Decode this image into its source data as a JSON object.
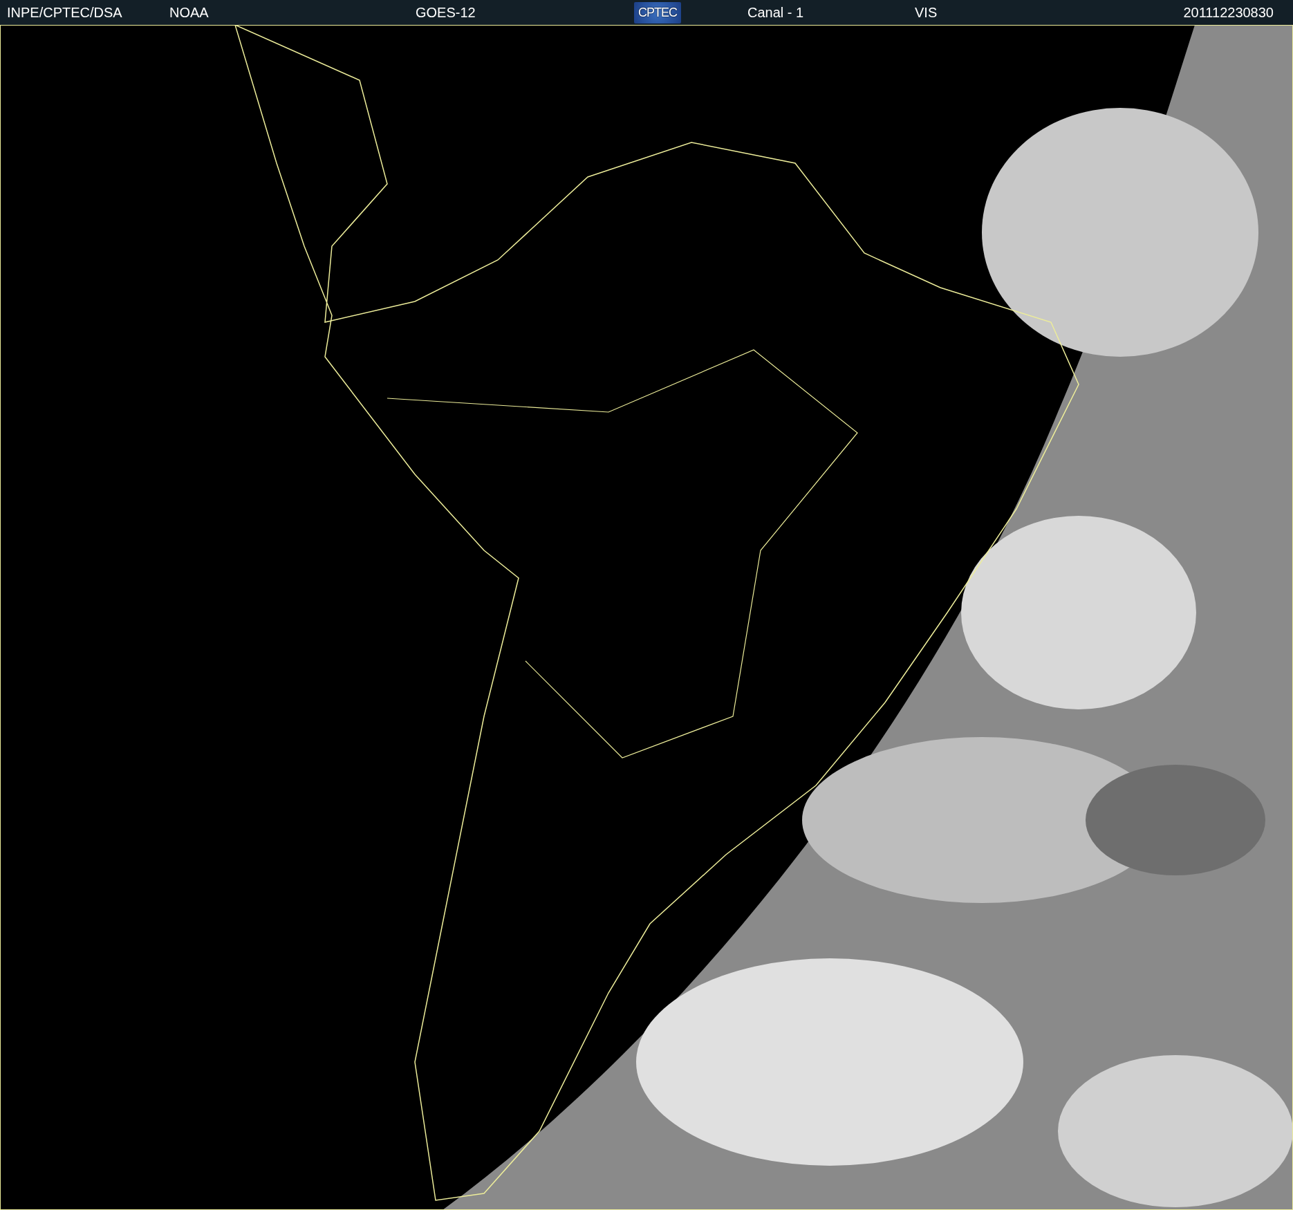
{
  "header": {
    "items": [
      {
        "kind": "text",
        "text": "INPE/CPTEC/DSA"
      },
      {
        "kind": "text",
        "text": "NOAA"
      },
      {
        "kind": "text",
        "text": "GOES-12"
      },
      {
        "kind": "logo",
        "text": "CPTEC"
      },
      {
        "kind": "text",
        "text": "Canal - 1"
      },
      {
        "kind": "text",
        "text": "VIS"
      },
      {
        "kind": "text",
        "text": "201112230830"
      }
    ]
  }
}
